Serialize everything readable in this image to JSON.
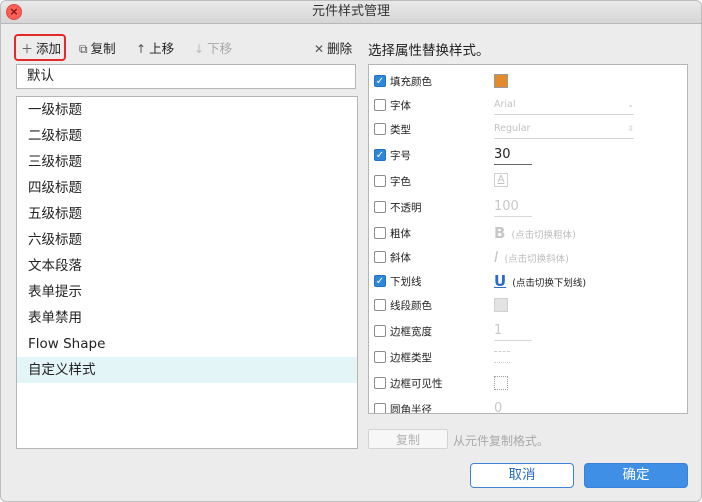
{
  "window": {
    "title": "元件样式管理"
  },
  "toolbar": {
    "add": {
      "icon": "plus-icon",
      "label": "添加"
    },
    "copy": {
      "icon": "copy-icon",
      "label": "复制"
    },
    "up": {
      "icon": "arrow-up-icon",
      "label": "上移"
    },
    "down": {
      "icon": "arrow-down-icon",
      "label": "下移"
    },
    "delete": {
      "icon": "close-icon",
      "label": "删除"
    }
  },
  "style_name": {
    "value": "默认"
  },
  "styles": [
    "一级标题",
    "二级标题",
    "三级标题",
    "四级标题",
    "五级标题",
    "六级标题",
    "文本段落",
    "表单提示",
    "表单禁用",
    "Flow Shape",
    "自定义样式"
  ],
  "selected_style": "自定义样式",
  "panel": {
    "title": "选择属性替换样式。"
  },
  "props": {
    "fill_color": {
      "label": "填充颜色",
      "checked": true,
      "color": "#e38a2a"
    },
    "font": {
      "label": "字体",
      "checked": false,
      "value": "Arial"
    },
    "type": {
      "label": "类型",
      "checked": false,
      "value": "Regular"
    },
    "size": {
      "label": "字号",
      "checked": true,
      "value": "30"
    },
    "font_color": {
      "label": "字色",
      "checked": false,
      "glyph": "A"
    },
    "opacity": {
      "label": "不透明",
      "checked": false,
      "value": "100"
    },
    "bold": {
      "label": "粗体",
      "checked": false,
      "glyph": "B",
      "hint": "(点击切换粗体)"
    },
    "italic": {
      "label": "斜体",
      "checked": false,
      "glyph": "I",
      "hint": "(点击切换斜体)"
    },
    "underline": {
      "label": "下划线",
      "checked": true,
      "glyph": "U",
      "hint": "(点击切换下划线)"
    },
    "line_color": {
      "label": "线段颜色",
      "checked": false
    },
    "border_width": {
      "label": "边框宽度",
      "checked": false,
      "value": "1"
    },
    "border_type": {
      "label": "边框类型",
      "checked": false
    },
    "border_visible": {
      "label": "边框可见性",
      "checked": false
    },
    "corner_radius": {
      "label": "圆角半径",
      "checked": false,
      "value": "0"
    }
  },
  "footer": {
    "copy_button": "复制",
    "copy_hint": "从元件复制格式。",
    "cancel": "取消",
    "ok": "确定"
  }
}
